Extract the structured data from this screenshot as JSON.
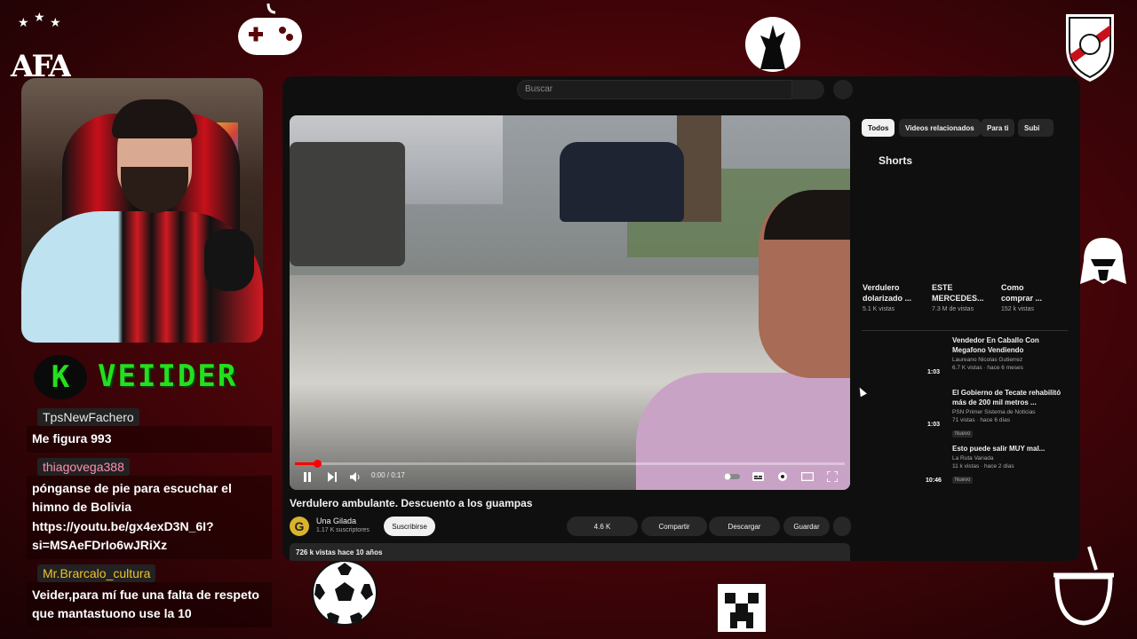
{
  "streamer": {
    "badge_letter": "K",
    "name": "VEIIDER"
  },
  "chat": [
    {
      "user": "TpsNewFachero",
      "user_color": "#e8e8e8",
      "text": "Me figura 993"
    },
    {
      "user": "thiagovega388",
      "user_color": "#ff8fb0",
      "text": "pónganse de pie para escuchar el himno de Bolivia https://youtu.be/gx4exD3N_6I?si=MSAeFDrIo6wJRiXz"
    },
    {
      "user": "Mr.Brarcalo_cultura",
      "user_color": "#f0c030",
      "text": "Veider,para mí fue una falta de respeto que mantastuono use la 10"
    }
  ],
  "decorations": {
    "afa_label": "AFA",
    "icons": [
      "afa-logo",
      "gamepad-icon",
      "goku-icon",
      "river-plate-shield-icon",
      "darth-vader-icon",
      "soccer-ball-icon",
      "creeper-icon",
      "mate-cup-icon"
    ]
  },
  "youtube": {
    "search_placeholder": "Buscar",
    "player": {
      "time": "0:00 / 0:17",
      "progress": 0.04,
      "controls": [
        "pause-icon",
        "next-icon",
        "volume-icon",
        "autoplay-toggle",
        "subtitles-icon",
        "settings-icon",
        "theater-icon",
        "fullscreen-icon"
      ]
    },
    "video_title": "Verdulero ambulante. Descuento a los guampas",
    "channel": {
      "avatar_letter": "G",
      "name": "Una Gilada",
      "subs": "1.17 K suscriptores"
    },
    "subscribe_label": "Suscribirse",
    "actions": {
      "likes": "4.6 K",
      "share": "Compartir",
      "download": "Descargar",
      "save": "Guardar"
    },
    "description_meta": "726 k vistas  hace 10 años",
    "chips": [
      "Todos",
      "Videos relacionados",
      "Para ti",
      "Subi"
    ],
    "shorts_title": "Shorts",
    "shorts": [
      {
        "title": "Verdulero\ndolarizado ...",
        "views": "5.1 K vistas"
      },
      {
        "title": "ESTE\nMERCEDES...",
        "views": "7.3 M de vistas"
      },
      {
        "title": "Como\ncomprar ...",
        "views": "152 k vistas"
      }
    ],
    "recommended": [
      {
        "title": "Vendedor En Caballo Con\nMegafono Vendiendo",
        "channel": "Laureano Nicolas Gutierrez",
        "meta": "6.7 K vistas · hace 6 meses",
        "duration": "1:03",
        "badge": ""
      },
      {
        "title": "El Gobierno de Tecate rehabilitó\nmás de 200 mil metros ...",
        "channel": "PSN Primer Sistema de Noticias",
        "meta": "71 vistas · hace 6 días",
        "duration": "1:03",
        "badge": "Nuevo"
      },
      {
        "title": "Esto puede salir MUY mal...",
        "channel": "La Ruta Variada",
        "meta": "11 k vistas · hace 2 días",
        "duration": "10:46",
        "badge": "Nuevo"
      }
    ]
  }
}
